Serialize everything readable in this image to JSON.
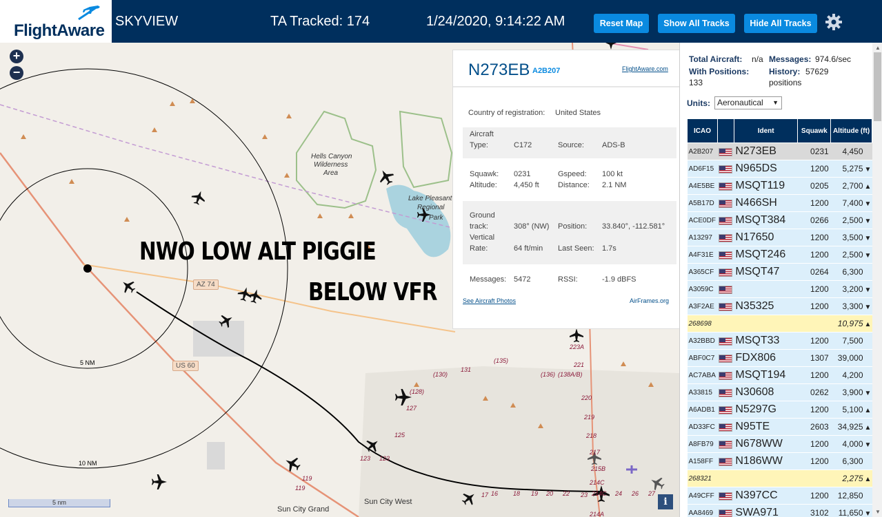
{
  "header": {
    "logo_text": "FlightAware",
    "app_name": "SKYVIEW",
    "ta_tracked": "TA Tracked: 174",
    "clock": "1/24/2020, 9:14:22 AM",
    "buttons": {
      "reset": "Reset Map",
      "show_all": "Show All Tracks",
      "hide_all": "Hide All Tracks"
    },
    "settings_icon": "gear-icon"
  },
  "map": {
    "zoom_in": "+",
    "zoom_out": "−",
    "annotation_1": "NWO LOW ALT PIGGIE",
    "annotation_2": "BELOW VFR",
    "labels": {
      "hells_canyon": "Hells Canyon",
      "wilderness": "Wilderness",
      "area": "Area",
      "lake_pleasant_1": "Lake Pleasant",
      "lake_pleasant_2": "Regional",
      "lake_pleasant_3": "Park",
      "az74": "AZ 74",
      "us60": "US 60",
      "ring_5": "5 NM",
      "ring_10": "10 NM",
      "sun_city_grand": "Sun City Grand",
      "sun_city_west": "Sun City West",
      "scale": "5 nm",
      "info": "i"
    },
    "road_numbers": [
      "(135)",
      "(130)",
      "131",
      "(136)",
      "(138A/B)",
      "(128)",
      "127",
      "125",
      "123",
      "123",
      "221",
      "223A",
      "220",
      "219",
      "218",
      "217",
      "215B",
      "214C",
      "214C",
      "214A",
      "119",
      "119",
      "17",
      "16",
      "18",
      "19",
      "20",
      "22",
      "23",
      "24",
      "26",
      "27"
    ]
  },
  "popup": {
    "ident": "N273EB",
    "hex": "A2B207",
    "fa_link": "FlightAware.com",
    "country_label": "Country of registration:",
    "country": "United States",
    "type_label_1": "Aircraft",
    "type_label_2": "Type:",
    "type": "C172",
    "source_label": "Source:",
    "source": "ADS-B",
    "squawk_label": "Squawk:",
    "squawk": "0231",
    "gspeed_label": "Gspeed:",
    "gspeed": "100 kt",
    "altitude_label": "Altitude:",
    "altitude": "4,450 ft",
    "distance_label": "Distance:",
    "distance": "2.1 NM",
    "track_label_1": "Ground",
    "track_label_2": "track:",
    "track": "308° (NW)",
    "position_label": "Position:",
    "position": "33.840°, -112.581°",
    "vrate_label_1": "Vertical",
    "vrate_label_2": "Rate:",
    "vrate": "64 ft/min",
    "lastseen_label": "Last Seen:",
    "lastseen": "1.7s",
    "messages_label": "Messages:",
    "messages": "5472",
    "rssi_label": "RSSI:",
    "rssi": "-1.9 dBFS",
    "photos_link": "See Aircraft Photos",
    "airframes_link": "AirFrames.org"
  },
  "sidebar": {
    "total_label": "Total Aircraft:",
    "total": "n/a",
    "messages_label": "Messages:",
    "messages": "974.6/sec",
    "positions_label": "With Positions:",
    "positions": "133",
    "history_label": "History:",
    "history": "57629",
    "history_unit": "positions",
    "units_label": "Units:",
    "units_value": "Aeronautical",
    "columns": [
      "ICAO",
      "",
      "Ident",
      "Squawk",
      "Altitude (ft)"
    ],
    "rows": [
      {
        "icao": "A2B207",
        "flag": true,
        "ident": "N273EB",
        "squawk": "0231",
        "alt": "4,450",
        "trend": "",
        "kind": "sel"
      },
      {
        "icao": "AD6F15",
        "flag": true,
        "ident": "N965DS",
        "squawk": "1200",
        "alt": "5,275",
        "trend": "▼",
        "kind": ""
      },
      {
        "icao": "A4E5BE",
        "flag": true,
        "ident": "MSQT119",
        "squawk": "0205",
        "alt": "2,700",
        "trend": "▲",
        "kind": ""
      },
      {
        "icao": "A5B17D",
        "flag": true,
        "ident": "N466SH",
        "squawk": "1200",
        "alt": "7,400",
        "trend": "▼",
        "kind": ""
      },
      {
        "icao": "ACE0DF",
        "flag": true,
        "ident": "MSQT384",
        "squawk": "0266",
        "alt": "2,500",
        "trend": "▼",
        "kind": ""
      },
      {
        "icao": "A13297",
        "flag": true,
        "ident": "N17650",
        "squawk": "1200",
        "alt": "3,500",
        "trend": "▼",
        "kind": ""
      },
      {
        "icao": "A4F31E",
        "flag": true,
        "ident": "MSQT246",
        "squawk": "1200",
        "alt": "2,500",
        "trend": "▼",
        "kind": ""
      },
      {
        "icao": "A365CF",
        "flag": true,
        "ident": "MSQT47",
        "squawk": "0264",
        "alt": "6,300",
        "trend": "",
        "kind": ""
      },
      {
        "icao": "A3059C",
        "flag": true,
        "ident": "",
        "squawk": "1200",
        "alt": "3,200",
        "trend": "▼",
        "kind": ""
      },
      {
        "icao": "A3F2AE",
        "flag": true,
        "ident": "N35325",
        "squawk": "1200",
        "alt": "3,300",
        "trend": "▼",
        "kind": ""
      },
      {
        "icao": "268698",
        "flag": false,
        "ident": "",
        "squawk": "",
        "alt": "10,975",
        "trend": "▲",
        "kind": "mlat"
      },
      {
        "icao": "A32BBD",
        "flag": true,
        "ident": "MSQT33",
        "squawk": "1200",
        "alt": "7,500",
        "trend": "",
        "kind": ""
      },
      {
        "icao": "ABF0C7",
        "flag": true,
        "ident": "FDX806",
        "squawk": "1307",
        "alt": "39,000",
        "trend": "",
        "kind": ""
      },
      {
        "icao": "AC7ABA",
        "flag": true,
        "ident": "MSQT194",
        "squawk": "1200",
        "alt": "4,200",
        "trend": "",
        "kind": ""
      },
      {
        "icao": "A33815",
        "flag": true,
        "ident": "N30608",
        "squawk": "0262",
        "alt": "3,900",
        "trend": "▼",
        "kind": ""
      },
      {
        "icao": "A6ADB1",
        "flag": true,
        "ident": "N5297G",
        "squawk": "1200",
        "alt": "5,100",
        "trend": "▲",
        "kind": ""
      },
      {
        "icao": "AD33FC",
        "flag": true,
        "ident": "N95TE",
        "squawk": "2603",
        "alt": "34,925",
        "trend": "▲",
        "kind": ""
      },
      {
        "icao": "A8FB79",
        "flag": true,
        "ident": "N678WW",
        "squawk": "1200",
        "alt": "4,000",
        "trend": "▼",
        "kind": ""
      },
      {
        "icao": "A158FF",
        "flag": true,
        "ident": "N186WW",
        "squawk": "1200",
        "alt": "6,300",
        "trend": "",
        "kind": ""
      },
      {
        "icao": "268321",
        "flag": false,
        "ident": "",
        "squawk": "",
        "alt": "2,275",
        "trend": "▲",
        "kind": "mlat"
      },
      {
        "icao": "A49CFF",
        "flag": true,
        "ident": "N397CC",
        "squawk": "1200",
        "alt": "12,850",
        "trend": "",
        "kind": ""
      },
      {
        "icao": "AA8469",
        "flag": true,
        "ident": "SWA971",
        "squawk": "3102",
        "alt": "11,650",
        "trend": "▼",
        "kind": ""
      }
    ]
  },
  "colors": {
    "header_bg": "#002f5d",
    "button_bg": "#0a8ae0",
    "row_bg": "#dceffb",
    "mlat_row_bg": "#fff5b8",
    "selected_row_bg": "#d9d9d9",
    "track_color": "#000000"
  }
}
